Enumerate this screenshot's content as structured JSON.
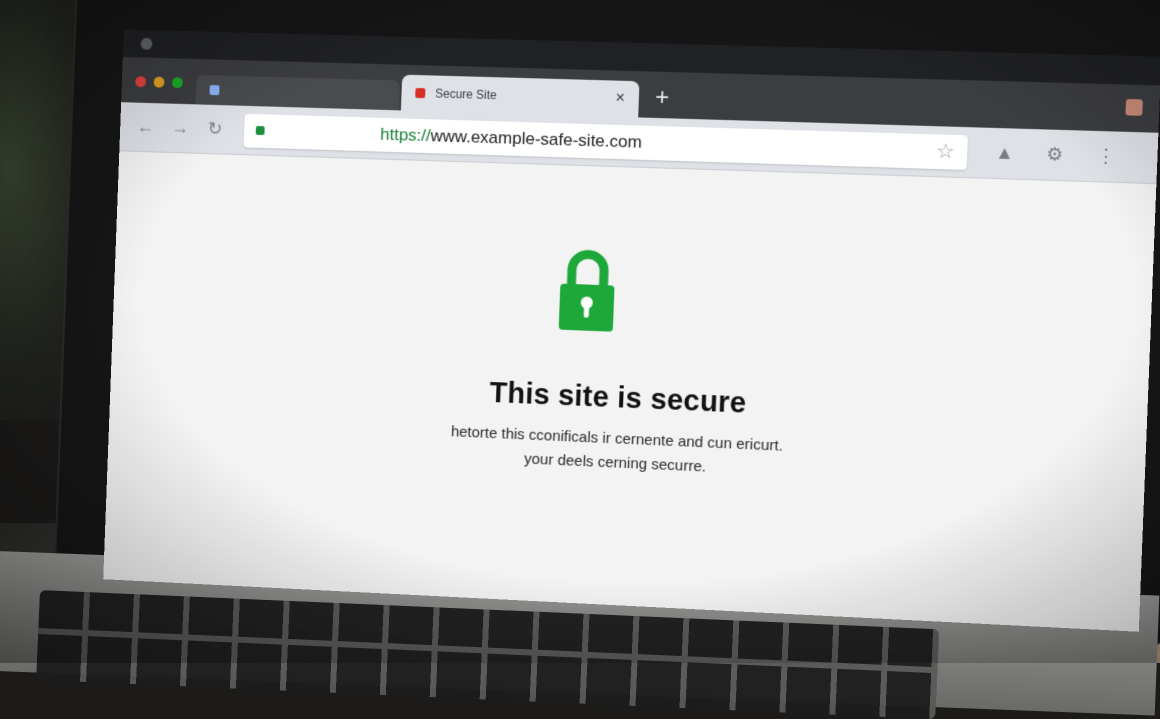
{
  "browser": {
    "os_title": "",
    "tabs": [
      {
        "title": "",
        "active": false
      },
      {
        "title": "Secure Site",
        "active": true
      }
    ],
    "tab_close_glyph": "×",
    "new_tab_glyph": "+",
    "address_bar": {
      "scheme": "https://",
      "host": "www.example-safe-site.com",
      "secure": true
    },
    "icons": {
      "back": "back-arrow-icon",
      "forward": "forward-arrow-icon",
      "reload": "reload-icon",
      "bookmark": "star-icon",
      "extension": "extension-icon",
      "settings": "gear-icon",
      "menu": "kebab-menu-icon"
    }
  },
  "page": {
    "lock_icon": "padlock-closed-icon",
    "lock_color": "#1fa83a",
    "headline": "This site is secure",
    "subtext_line_1": "hetorte this cconificals ir cernente and cun ericurt.",
    "subtext_line_2": "your deels cerning securre."
  }
}
